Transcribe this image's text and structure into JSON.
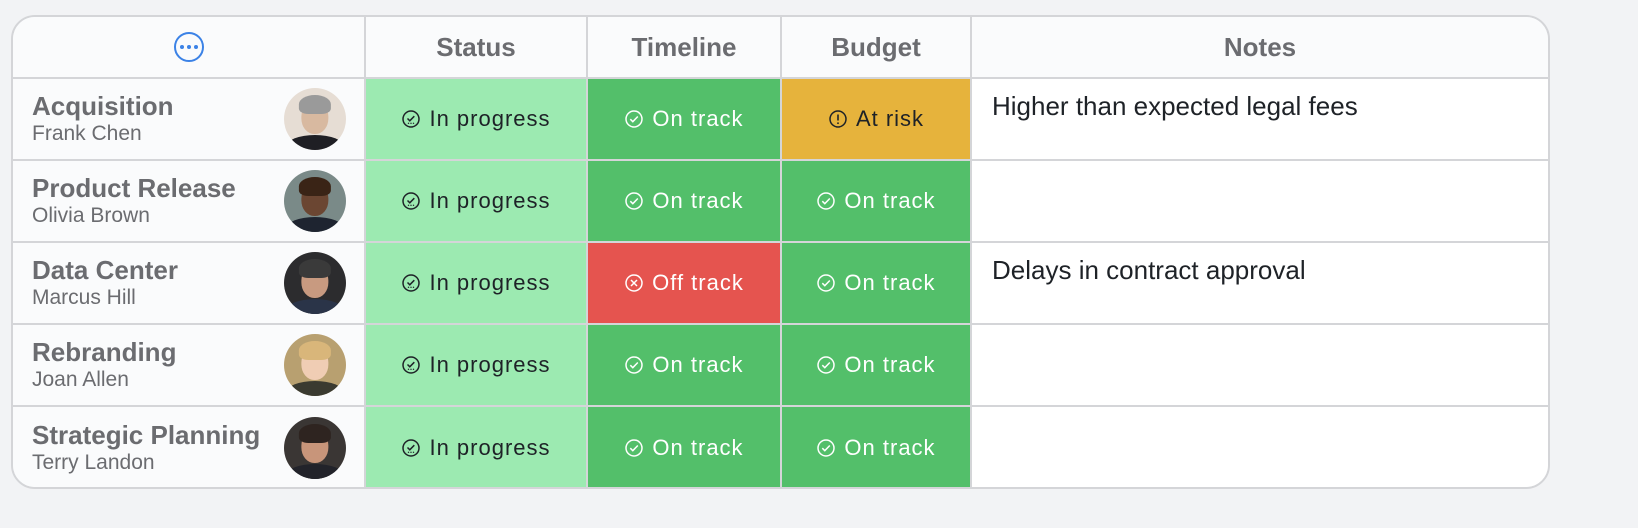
{
  "header": {
    "menu_icon": "more-horizontal-circle-icon",
    "columns": [
      "Status",
      "Timeline",
      "Budget",
      "Notes"
    ]
  },
  "colors": {
    "accent": "#3b82e6",
    "in_progress": "#9ceab1",
    "on_track": "#53bf6a",
    "at_risk": "#e6b33c",
    "off_track": "#e5544f"
  },
  "rows": [
    {
      "project": "Acquisition",
      "owner": "Frank Chen",
      "status": {
        "label": "In progress",
        "icon": "progress-check-icon"
      },
      "timeline": {
        "label": "On track",
        "icon": "check-circle-icon"
      },
      "budget": {
        "label": "At risk",
        "icon": "alert-circle-icon"
      },
      "notes": "Higher than expected legal fees"
    },
    {
      "project": "Product Release",
      "owner": "Olivia Brown",
      "status": {
        "label": "In progress",
        "icon": "progress-check-icon"
      },
      "timeline": {
        "label": "On track",
        "icon": "check-circle-icon"
      },
      "budget": {
        "label": "On track",
        "icon": "check-circle-icon"
      },
      "notes": ""
    },
    {
      "project": "Data Center",
      "owner": "Marcus Hill",
      "status": {
        "label": "In progress",
        "icon": "progress-check-icon"
      },
      "timeline": {
        "label": "Off track",
        "icon": "x-circle-icon"
      },
      "budget": {
        "label": "On track",
        "icon": "check-circle-icon"
      },
      "notes": "Delays in contract approval"
    },
    {
      "project": "Rebranding",
      "owner": "Joan Allen",
      "status": {
        "label": "In progress",
        "icon": "progress-check-icon"
      },
      "timeline": {
        "label": "On track",
        "icon": "check-circle-icon"
      },
      "budget": {
        "label": "On track",
        "icon": "check-circle-icon"
      },
      "notes": ""
    },
    {
      "project": "Strategic Planning",
      "owner": "Terry Landon",
      "status": {
        "label": "In progress",
        "icon": "progress-check-icon"
      },
      "timeline": {
        "label": "On track",
        "icon": "check-circle-icon"
      },
      "budget": {
        "label": "On track",
        "icon": "check-circle-icon"
      },
      "notes": ""
    }
  ]
}
